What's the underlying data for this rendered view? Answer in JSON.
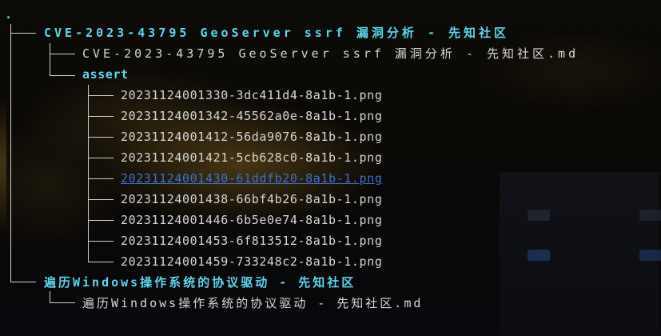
{
  "terminal": {
    "root": ".",
    "folder1": {
      "name": "CVE-2023-43795 GeoServer ssrf 漏洞分析 - 先知社区",
      "md": "CVE-2023-43795 GeoServer ssrf 漏洞分析 - 先知社区.md",
      "subfolder": "assert",
      "files": [
        "20231124001330-3dc411d4-8a1b-1.png",
        "20231124001342-45562a0e-8a1b-1.png",
        "20231124001412-56da9076-8a1b-1.png",
        "20231124001421-5cb628c0-8a1b-1.png",
        "20231124001430-61ddfb20-8a1b-1.png",
        "20231124001438-66bf4b26-8a1b-1.png",
        "20231124001446-6b5e0e74-8a1b-1.png",
        "20231124001453-6f813512-8a1b-1.png",
        "20231124001459-733248c2-8a1b-1.png"
      ]
    },
    "folder2": {
      "name": "遍历Windows操作系统的协议驱动 - 先知社区",
      "md": "遍历Windows操作系统的协议驱动 - 先知社区.md"
    }
  },
  "colors": {
    "directory": "#5bd6ea",
    "file": "#d6d6d6",
    "highlighted_link": "#3f6fd0"
  }
}
